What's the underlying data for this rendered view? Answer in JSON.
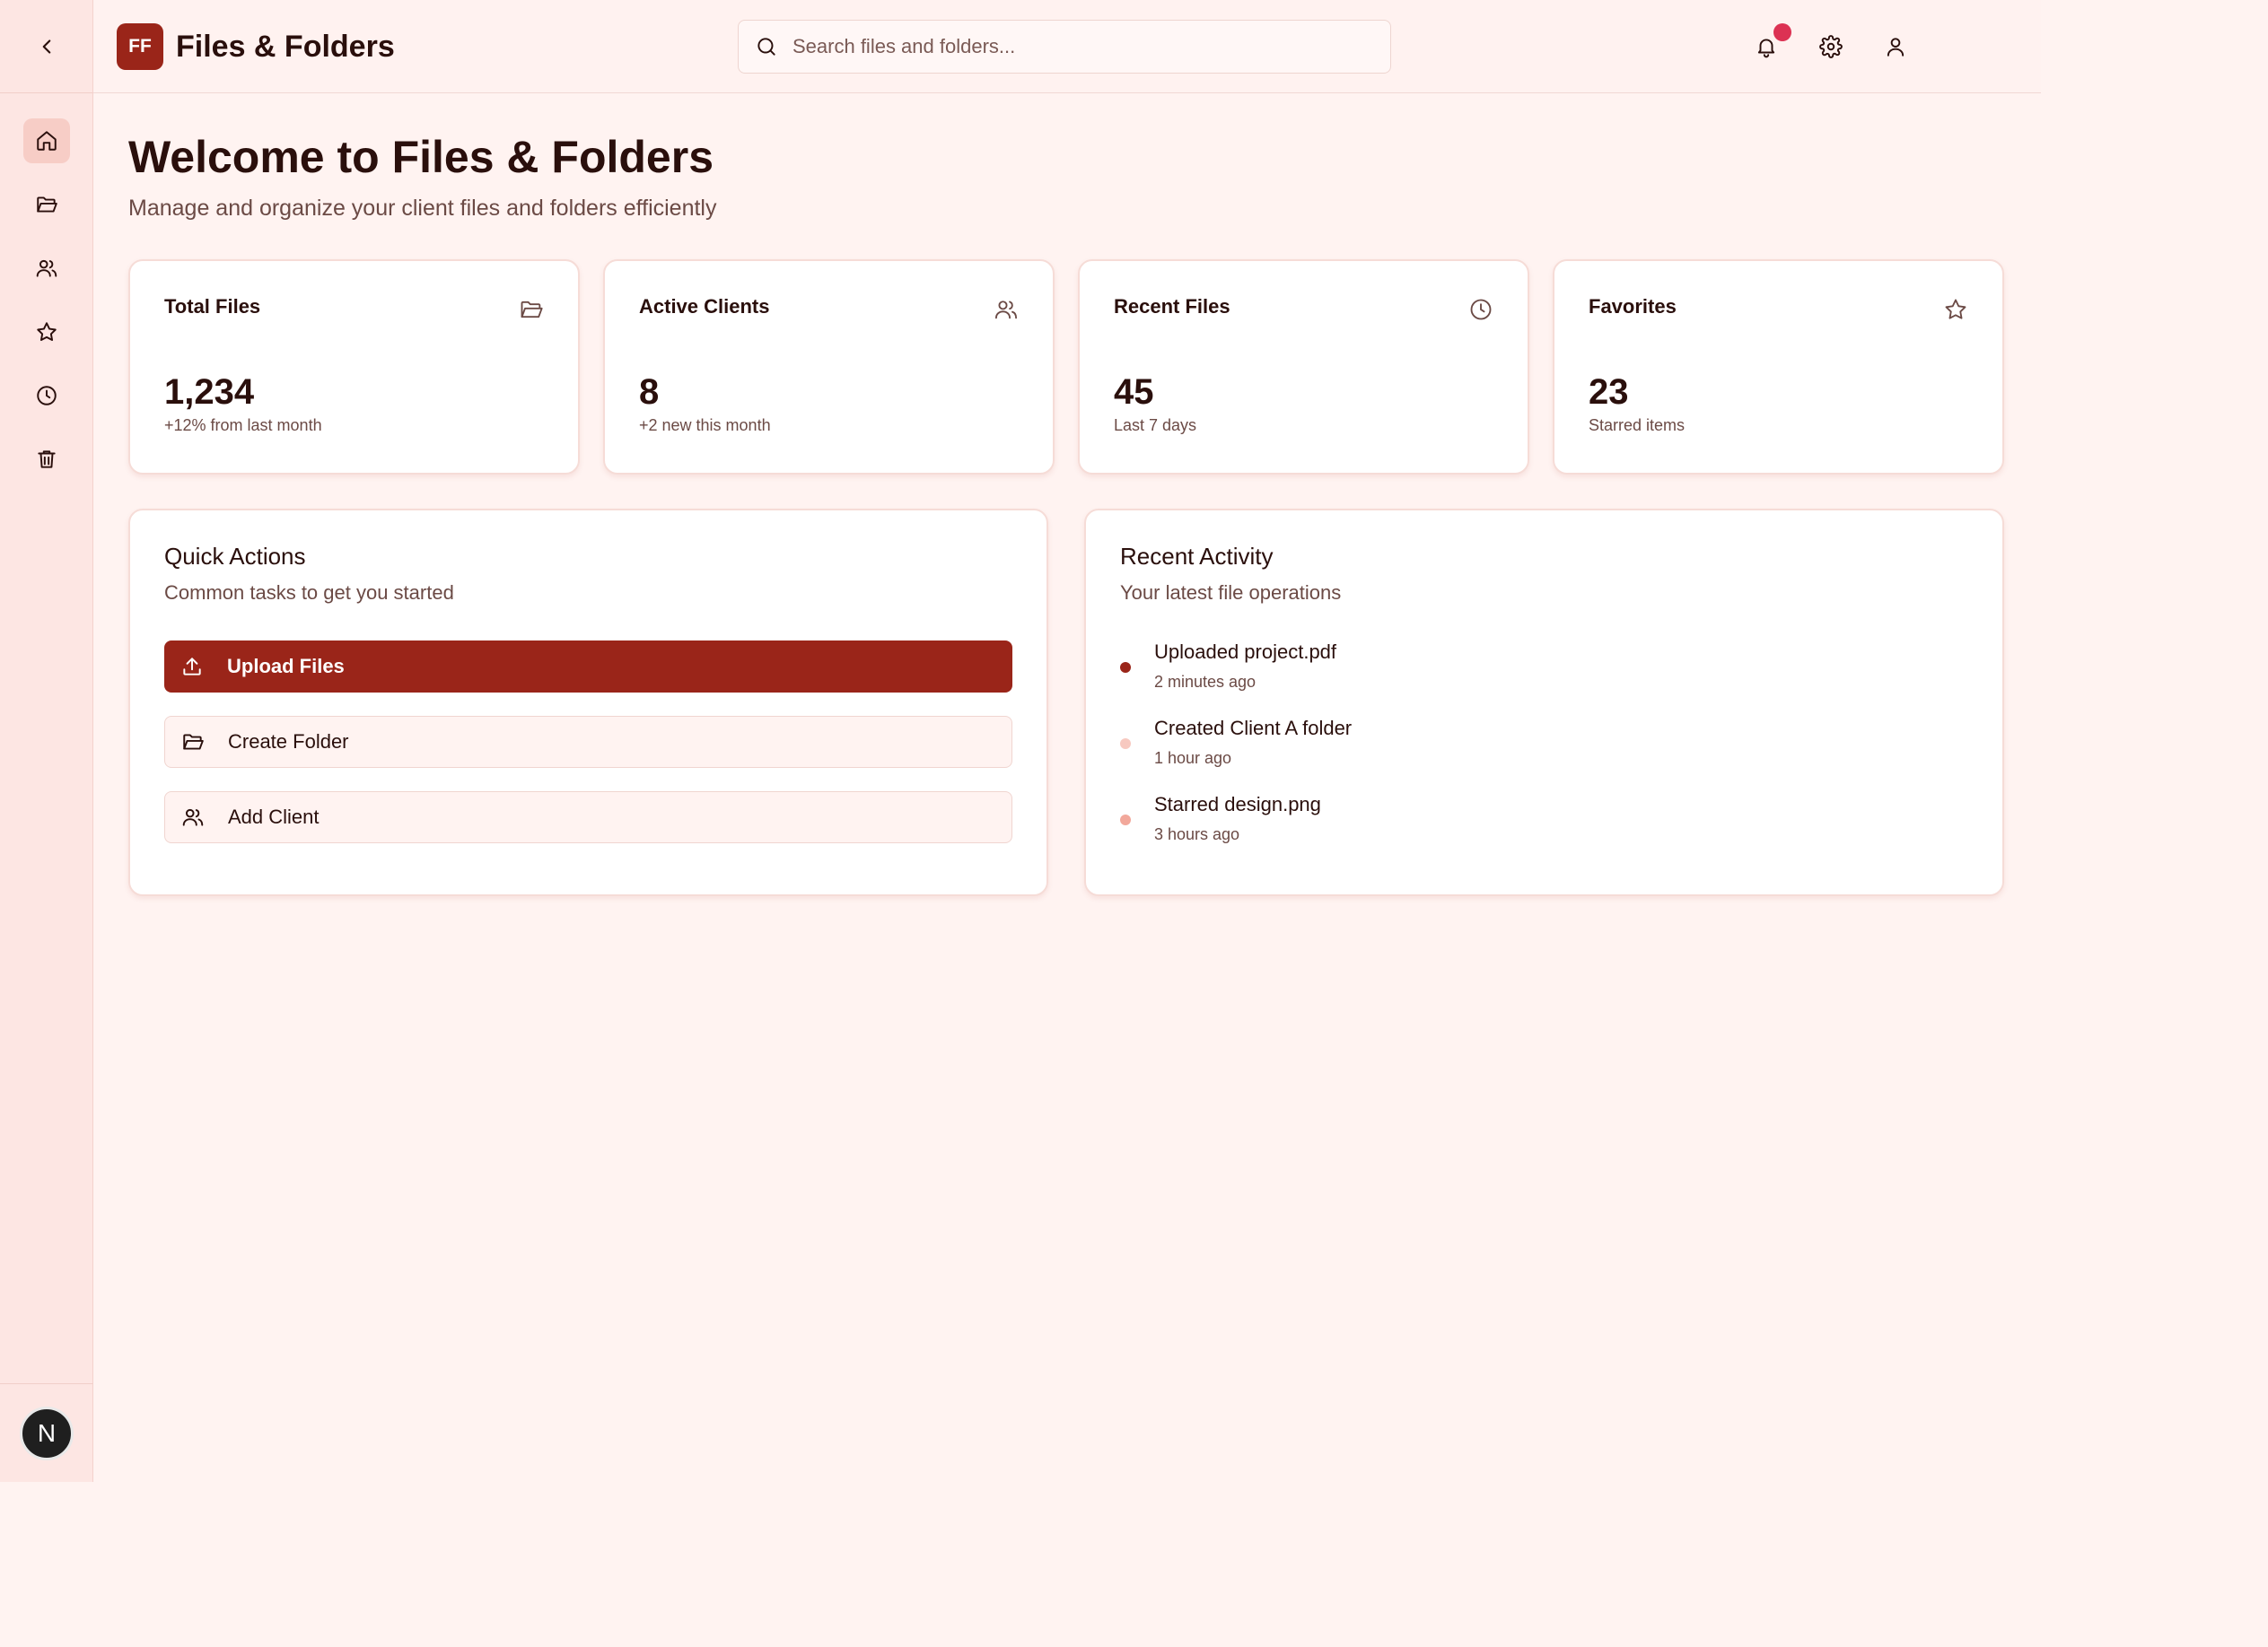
{
  "app": {
    "logo_text": "FF",
    "title": "Files & Folders"
  },
  "search": {
    "placeholder": "Search files and folders..."
  },
  "header": {
    "icons": [
      "bell-icon",
      "gear-icon",
      "user-icon"
    ],
    "notification_color": "#dc3253"
  },
  "sidebar": {
    "items": [
      {
        "icon": "home-icon",
        "active": true
      },
      {
        "icon": "folder-open-icon",
        "active": false
      },
      {
        "icon": "users-icon",
        "active": false
      },
      {
        "icon": "star-icon",
        "active": false
      },
      {
        "icon": "clock-icon",
        "active": false
      },
      {
        "icon": "trash-icon",
        "active": false
      }
    ],
    "avatar_letter": "N"
  },
  "main": {
    "title": "Welcome to Files & Folders",
    "subtitle": "Manage and organize your client files and folders efficiently"
  },
  "stats": [
    {
      "label": "Total Files",
      "value": "1,234",
      "note": "+12% from last month",
      "icon": "folder-open-icon"
    },
    {
      "label": "Active Clients",
      "value": "8",
      "note": "+2 new this month",
      "icon": "users-icon"
    },
    {
      "label": "Recent Files",
      "value": "45",
      "note": "Last 7 days",
      "icon": "clock-icon"
    },
    {
      "label": "Favorites",
      "value": "23",
      "note": "Starred items",
      "icon": "star-icon"
    }
  ],
  "quick_actions": {
    "title": "Quick Actions",
    "subtitle": "Common tasks to get you started",
    "items": [
      {
        "label": "Upload Files",
        "icon": "upload-icon"
      },
      {
        "label": "Create Folder",
        "icon": "folder-open-icon"
      },
      {
        "label": "Add Client",
        "icon": "users-icon"
      }
    ]
  },
  "recent_activity": {
    "title": "Recent Activity",
    "subtitle": "Your latest file operations",
    "items": [
      {
        "title": "Uploaded project.pdf",
        "time": "2 minutes ago",
        "dot_color": "#9a2519"
      },
      {
        "title": "Created Client A folder",
        "time": "1 hour ago",
        "dot_color": "#f7c9c0"
      },
      {
        "title": "Starred design.png",
        "time": "3 hours ago",
        "dot_color": "#f2a89b"
      }
    ]
  },
  "colors": {
    "accent": "#9a2519",
    "background": "#fff3f1",
    "sidebar": "#fde6e3"
  }
}
